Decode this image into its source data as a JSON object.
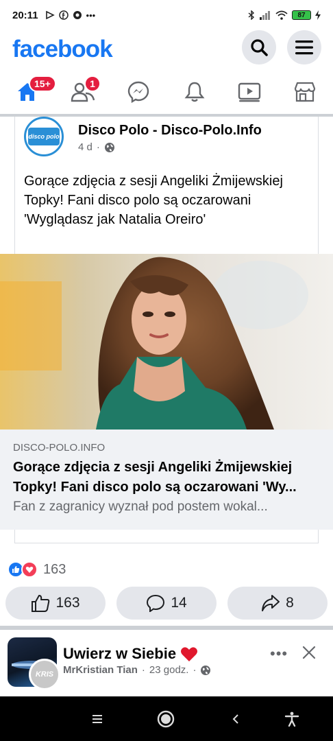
{
  "status_bar": {
    "time": "20:11",
    "battery": "87"
  },
  "header": {
    "logo": "facebook"
  },
  "nav": {
    "home_badge": "15+",
    "friends_badge": "1"
  },
  "shared_post": {
    "page_name": "Disco Polo - Disco-Polo.Info",
    "time_ago": "4 d",
    "avatar_text": "disco polo",
    "text": "Gorące zdjęcia z sesji Angeliki Żmijewskiej Topky! Fani disco polo są oczarowani 'Wyglądasz jak Natalia Oreiro'"
  },
  "link_preview": {
    "domain": "DISCO-POLO.INFO",
    "title_line1": "Gorące zdjęcia z sesji Angeliki Żmijewskiej",
    "title_line2": "Topky! Fani disco polo są oczarowani 'Wy...",
    "description": "Fan z zagranicy wyznał pod postem wokal..."
  },
  "reactions": {
    "count": "163"
  },
  "actions": {
    "likes": "163",
    "comments": "14",
    "shares": "8"
  },
  "next_post": {
    "title": "Uwierz w Siebie",
    "author": "MrKristian Tian",
    "time_ago": "23 godz.",
    "avatar_badge": "KRIS"
  },
  "colors": {
    "brand": "#1877f2",
    "badge": "#e41e3f",
    "love": "#f33e58"
  },
  "icons": [
    "home-icon",
    "friends-icon",
    "messenger-icon",
    "bell-icon",
    "watch-icon",
    "marketplace-icon",
    "search-icon",
    "menu-icon",
    "globe-icon",
    "like-icon",
    "comment-icon",
    "share-icon",
    "close-icon"
  ]
}
